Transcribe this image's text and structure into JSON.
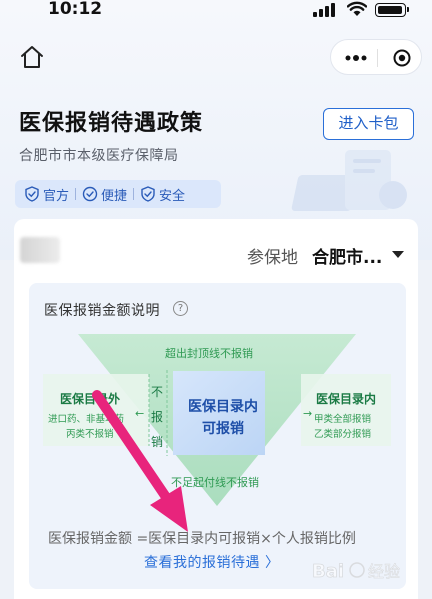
{
  "status_bar": {
    "time": "10:12"
  },
  "nav": {
    "home_icon": "home-icon",
    "more_icon": "more-dots-icon",
    "target_icon": "target-icon"
  },
  "header": {
    "title": "医保报销待遇政策",
    "subtitle": "合肥市市本级医疗保障局",
    "card_button": "进入卡包",
    "badges": [
      "官方",
      "便捷",
      "安全"
    ]
  },
  "location": {
    "label": "参保地",
    "value": "合肥市..."
  },
  "explanation": {
    "title": "医保报销金额说明",
    "diagram": {
      "cap_text": "超出封顶线不报销",
      "outside_title": "医保目录外",
      "outside_sub1": "进口药、非基本药",
      "outside_sub2": "丙类不报销",
      "vertical_text": "不报销",
      "center_text": "医保目录内可报销",
      "inside_title": "医保目录内",
      "inside_sub1": "甲类全部报销",
      "inside_sub2": "乙类部分报销",
      "floor_text": "不足起付线不报销"
    },
    "formula": "医保报销金额 =医保目录内可报销×个人报销比例",
    "link": "查看我的报销待遇 〉"
  },
  "colors": {
    "accent": "#2a6fd8",
    "green": "#2f9a53",
    "arrow": "#e8247c"
  }
}
